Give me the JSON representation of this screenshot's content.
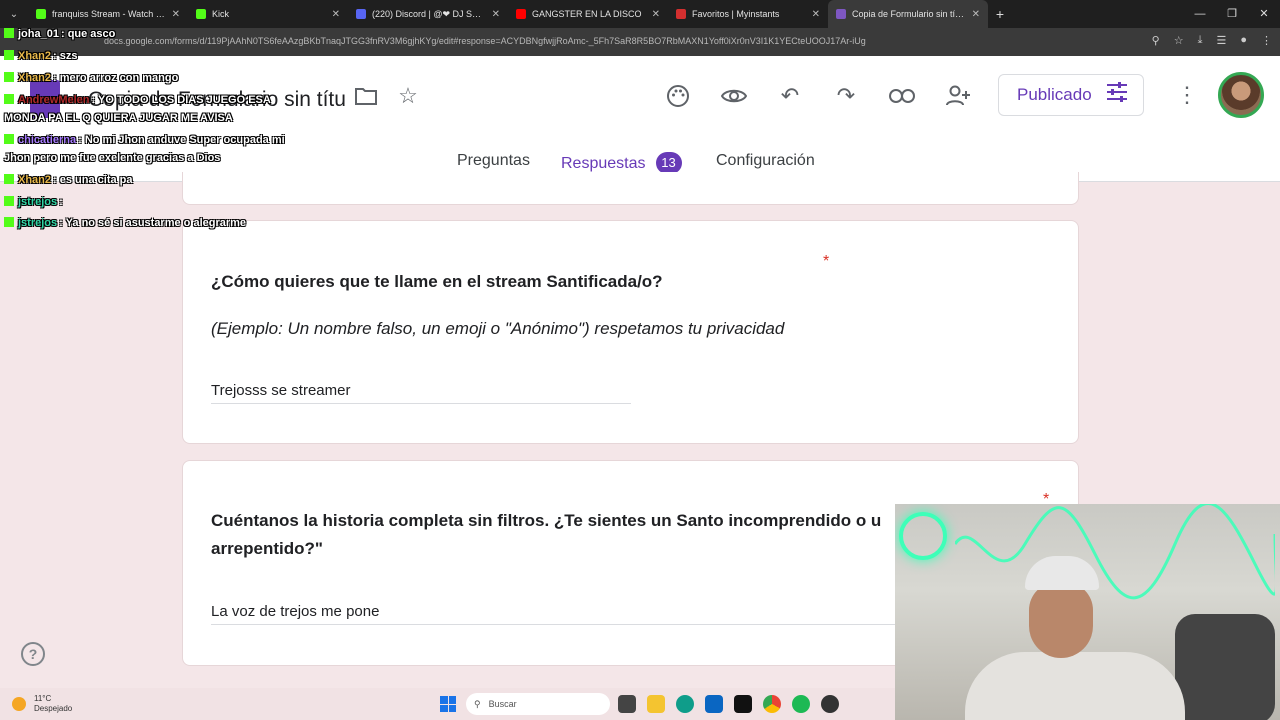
{
  "browser": {
    "tabs": [
      {
        "title": "franquiss Stream - Watch Live o",
        "color": "#53fc18",
        "active": false
      },
      {
        "title": "Kick",
        "color": "#53fc18",
        "active": false
      },
      {
        "title": "(220) Discord | @❤ DJ SANRO",
        "color": "#5865f2",
        "active": false
      },
      {
        "title": "GANGSTER EN LA DISCO",
        "color": "#ff0000",
        "active": false
      },
      {
        "title": "Favoritos | Myinstants",
        "color": "#d32f2f",
        "active": false
      },
      {
        "title": "Copia de Formulario sin título",
        "color": "#7e57c2",
        "active": true
      }
    ],
    "url": "docs.google.com/forms/d/119PjAAhN0TS6feAAzgBKbTnaqJTGG3fnRV3M6gjhKYg/edit#response=ACYDBNgfwjjRoAmc-_5Fh7SaR8R5BO7RbMAXN1Yoff0iXr0nV3I1K1YECteUOOJ17Ar-iUg"
  },
  "header": {
    "title": "Copia de Formulario sin títu",
    "publish_label": "Publicado",
    "tabs": {
      "questions": "Preguntas",
      "responses": "Respuestas",
      "responses_count": "13",
      "settings": "Configuración"
    }
  },
  "questions": [
    {
      "title": "¿Cómo quieres que te llame en el stream Santificada/o?",
      "description": "(Ejemplo: Un nombre falso, un emoji o \"Anónimo\") respetamos tu privacidad",
      "answer": "Trejosss se streamer",
      "required_mark": "*"
    },
    {
      "title_line1": "Cuéntanos la historia completa sin filtros. ¿Te sientes un Santo incomprendido o u",
      "title_line2": "arrepentido?\"",
      "answer": "La voz de trejos me pone",
      "required_mark": "*"
    }
  ],
  "chat": [
    {
      "user": "joha_01",
      "message": ": que asco",
      "color": "#ffffff"
    },
    {
      "user": "Xhan2",
      "message": ": szs",
      "color": "#e8b84a"
    },
    {
      "user": "Xhan2",
      "message": ": mero arroz con mango",
      "color": "#e8b84a"
    },
    {
      "user": "AndrewMelen",
      "message": ": YO TODO LOS DIAS JUEGO ESA",
      "color": "#b02a2a"
    },
    {
      "user": "",
      "message": "MONDA PA EL Q QUIERA JUGAR ME AVISA",
      "color": "#ffffff"
    },
    {
      "user": "chicatierna",
      "message": ": No mi Jhon anduve Super ocupada mi",
      "color": "#a77bff"
    },
    {
      "user": "",
      "message": "Jhon pero me fue exelente gracias a Dios",
      "color": "#ffffff"
    },
    {
      "user": "Xhan2",
      "message": ": es una cita pa",
      "color": "#e8b84a"
    },
    {
      "user": "jstrejos",
      "message": ":",
      "color": "#2fd6a5"
    },
    {
      "user": "jstrejos",
      "message": ": Ya no sé si asustarme o alegrarme",
      "color": "#2fd6a5"
    }
  ],
  "taskbar": {
    "temperature": "11°C",
    "weather": "Despejado",
    "search_placeholder": "Buscar"
  }
}
